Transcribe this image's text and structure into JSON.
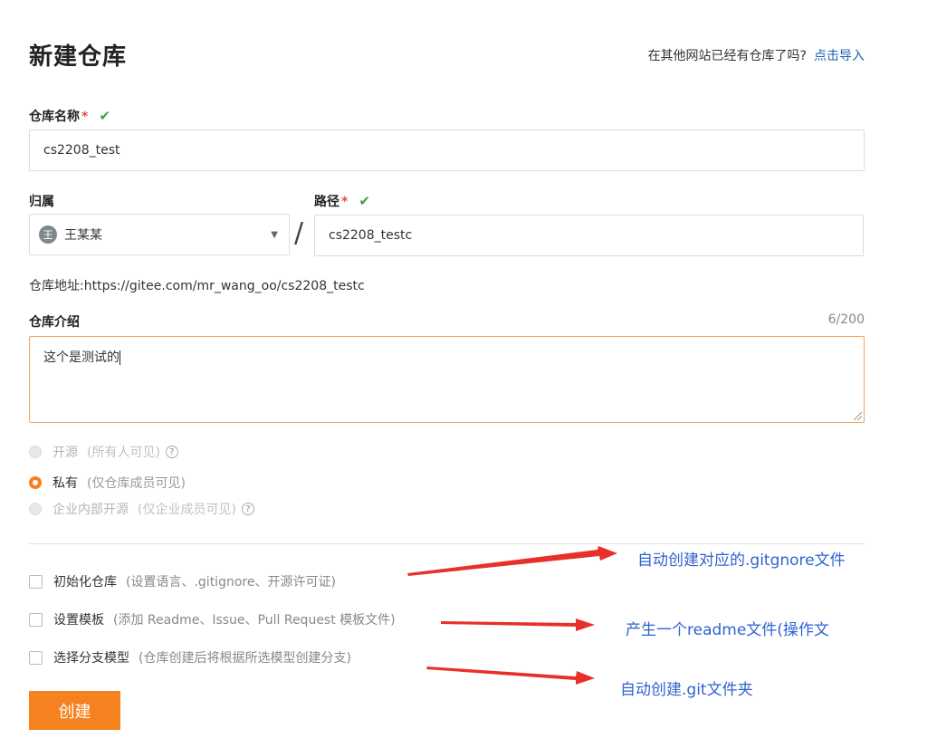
{
  "page": {
    "title": "新建仓库",
    "import_prompt": "在其他网站已经有仓库了吗?",
    "import_link": "点击导入"
  },
  "repo_name": {
    "label": "仓库名称",
    "required_mark": "*",
    "value": "cs2208_test"
  },
  "owner": {
    "label": "归属",
    "avatar_text": "王",
    "value": "王某某"
  },
  "path_separator": "/",
  "path": {
    "label": "路径",
    "required_mark": "*",
    "value": "cs2208_testc"
  },
  "repo_url": "仓库地址:https://gitee.com/mr_wang_oo/cs2208_testc",
  "description": {
    "label": "仓库介绍",
    "counter": "6/200",
    "value": "这个是测试的"
  },
  "visibility": [
    {
      "label": "开源",
      "hint": "(所有人可见)",
      "selected": false,
      "disabled": true
    },
    {
      "label": "私有",
      "hint": "(仅仓库成员可见)",
      "selected": true,
      "disabled": false
    },
    {
      "label": "企业内部开源",
      "hint": "(仅企业成员可见)",
      "selected": false,
      "disabled": true
    }
  ],
  "options": [
    {
      "label": "初始化仓库",
      "hint": "(设置语言、.gitignore、开源许可证)",
      "checked": false
    },
    {
      "label": "设置模板",
      "hint": "(添加 Readme、Issue、Pull Request 模板文件)",
      "checked": false
    },
    {
      "label": "选择分支模型",
      "hint": "(仓库创建后将根据所选模型创建分支)",
      "checked": false
    }
  ],
  "submit_label": "创建",
  "annotations": [
    "自动创建对应的.gitgnore文件",
    "产生一个readme文件(操作文",
    "自动创建.git文件夹"
  ],
  "colors": {
    "accent": "#f5821f",
    "link": "#1b63b3",
    "annotation": "#2f63d0",
    "arrow": "#e8302a",
    "check": "#3aa13a"
  }
}
